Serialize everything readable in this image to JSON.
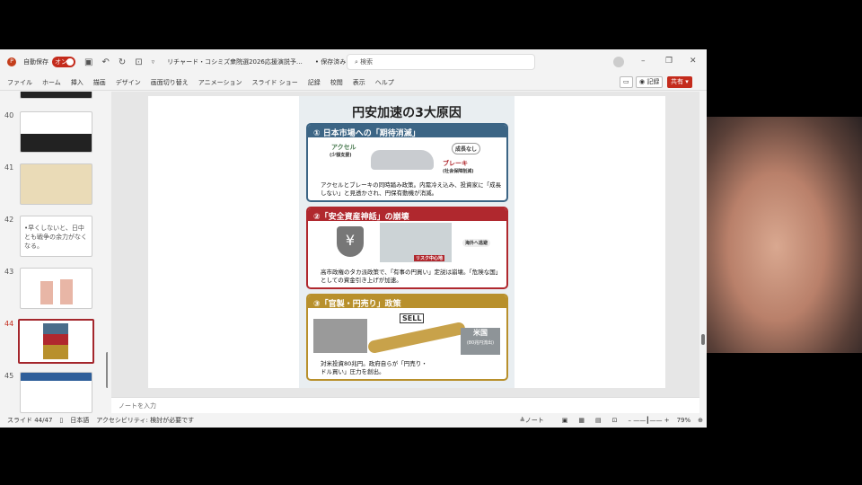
{
  "titlebar": {
    "autosave_label": "自動保存",
    "autosave_state": "オン",
    "doc_title": "リチャード・コシミズ衆院選2026応援演説予…",
    "saved_label": "• 保存済み ∨",
    "search_placeholder": "検索",
    "minimize": "–",
    "restore": "❐",
    "close": "✕"
  },
  "ribbon": {
    "tabs": [
      "ファイル",
      "ホーム",
      "挿入",
      "描画",
      "デザイン",
      "画面切り替え",
      "アニメーション",
      "スライド ショー",
      "記録",
      "校閲",
      "表示",
      "ヘルプ"
    ],
    "record_label": "◉ 記録",
    "share_label": "共有 ▾",
    "comment_icon": "comment-icon"
  },
  "thumbnails": [
    {
      "num": "40"
    },
    {
      "num": "41"
    },
    {
      "num": "42",
      "text": "•早くしないと、日中とも戦争の余力がなくなる。"
    },
    {
      "num": "43"
    },
    {
      "num": "44",
      "selected": true
    },
    {
      "num": "45"
    }
  ],
  "slide": {
    "title": "円安加速の3大原因",
    "sections": [
      {
        "heading": "① 日本市場への「期待消滅」",
        "color": "#3c6585",
        "labels": [
          "アクセル",
          "(少額支援)",
          "ブレーキ",
          "(社会保障削減)",
          "成長なし"
        ],
        "body": "アクセルとブレーキの同時踏み政策。内需冷え込み、投資家に「成長しない」と見透かされ、円保有動機が消滅。"
      },
      {
        "heading": "②「安全資産神話」の崩壊",
        "color": "#b0282e",
        "labels": [
          "リスク中心地",
          "海外へ逃避"
        ],
        "body": "高市政権のタカ派政策で、「有事の円買い」定説は崩壊。「危険な国」としての資金引き上げが加速。"
      },
      {
        "heading": "③「官製・円売り」政策",
        "color": "#b8902c",
        "labels": [
          "SELL",
          "米国",
          "(80兆円流出)"
        ],
        "body": "対米投資80兆円。政府自らが「円売り・ドル買い」圧力を創出。"
      }
    ]
  },
  "notes": {
    "placeholder": "ノートを入力"
  },
  "status": {
    "slide": "スライド 44/47",
    "language": "日本語",
    "accessibility": "アクセシビリティ: 検討が必要です",
    "notes_btn": "≜ノート",
    "zoom": "79%"
  }
}
